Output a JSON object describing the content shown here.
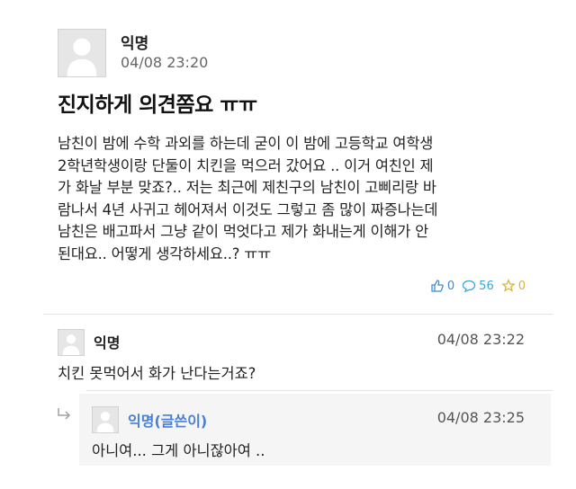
{
  "post": {
    "author": "익명",
    "time": "04/08 23:20",
    "title": "진지하게 의견쫌요 ㅠㅠ",
    "body": "남친이 밤에 수학 과외를 하는데 굳이 이 밤에 고등학교 여학생\n2학년학생이랑 단둘이 치킨을 먹으러 갔어요 .. 이거 여친인 제\n가 화날 부분 맞죠?.. 저는 최근에 제친구의 남친이 고삐리랑 바\n람나서 4년 사귀고 헤어져서 이것도 그렇고 좀 많이 짜증나는데\n남친은 배고파서 그냥 같이 먹엇다고 제가 화내는게 이해가 안\n된대요.. 어떻게 생각하세요..? ㅠㅠ",
    "stats": {
      "likes": "0",
      "comments": "56",
      "scraps": "0"
    }
  },
  "comments": [
    {
      "author": "익명",
      "time": "04/08 23:22",
      "text": "치킨 못먹어서 화가 난다는거죠?"
    },
    {
      "author": "익명(글쓴이)",
      "time": "04/08 23:25",
      "text": "아니여... 그게 아니잖아여 .."
    }
  ],
  "icons": {
    "avatar": "default-avatar-icon",
    "like": "thumbs-up-icon",
    "comment": "speech-bubble-icon",
    "scrap": "star-icon",
    "reply": "reply-arrow-icon"
  },
  "colors": {
    "like": "#3b8bd8",
    "comment": "#3ba5d8",
    "scrap": "#d8b43b",
    "op_author": "#4a7fd6"
  }
}
